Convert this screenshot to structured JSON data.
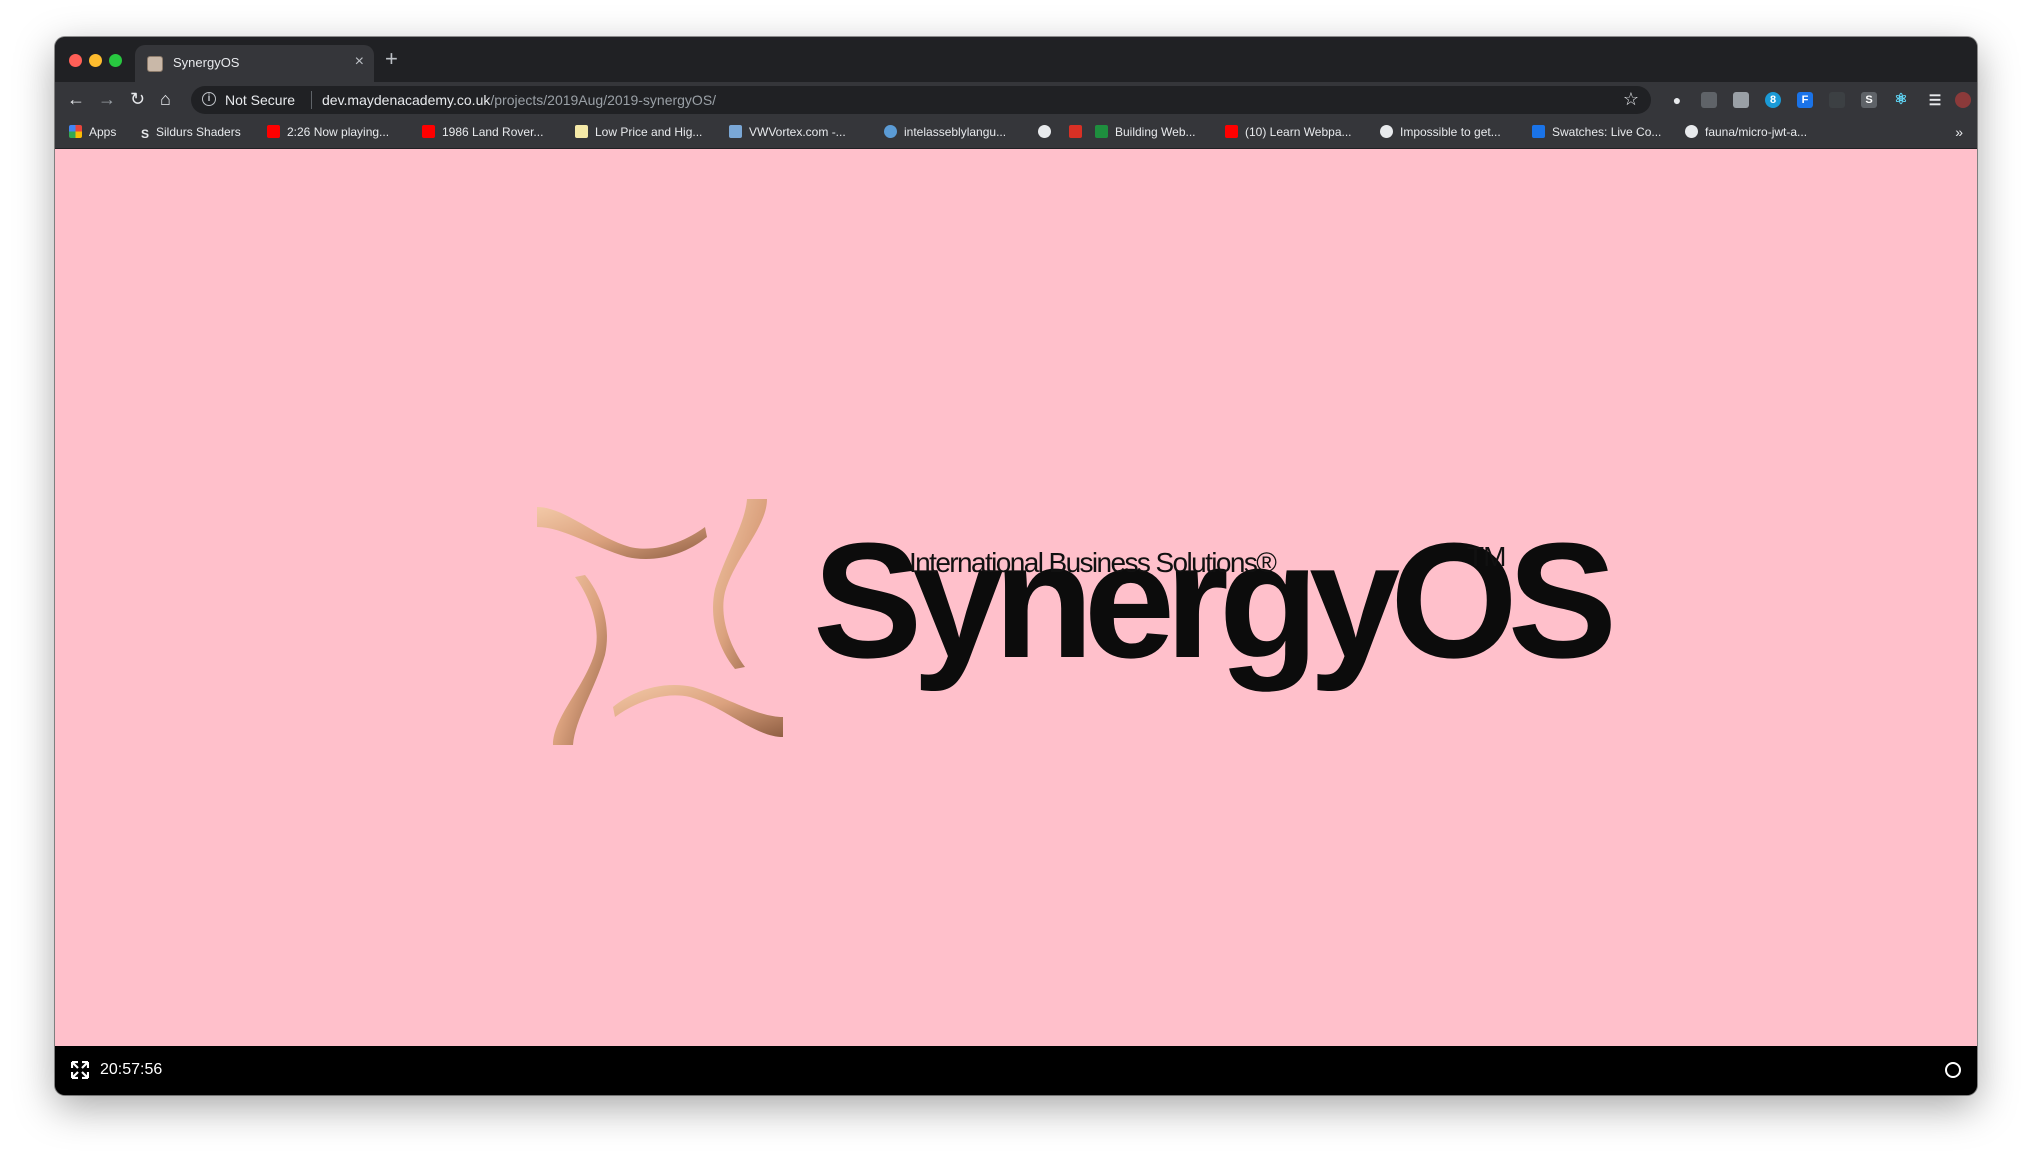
{
  "browser": {
    "tab": {
      "title": "SynergyOS",
      "close_glyph": "×"
    },
    "new_tab_glyph": "+",
    "security_label": "Not Secure",
    "url_host": "dev.maydenacademy.co.uk",
    "url_path": "/projects/2019Aug/2019-synergyOS/",
    "bookmarks": [
      {
        "label": "Apps",
        "icon": "apps-grid-icon",
        "color": "#e8453c"
      },
      {
        "label": "Sildurs Shaders",
        "icon": "letter-s-icon",
        "color": "#35363a"
      },
      {
        "label": "2:26 Now playing...",
        "icon": "youtube-icon",
        "color": "#ff0000"
      },
      {
        "label": "1986 Land Rover...",
        "icon": "youtube-icon",
        "color": "#ff0000"
      },
      {
        "label": "Low Price and Hig...",
        "icon": "note-icon",
        "color": "#f5e9a8"
      },
      {
        "label": "VWVortex.com -...",
        "icon": "vortex-icon",
        "color": "#7aa7d6"
      },
      {
        "label": "intelasseblylangu...",
        "icon": "wordpress-icon",
        "color": "#5b9bd5"
      },
      {
        "label": "",
        "icon": "globe-icon",
        "color": "#e8eaed"
      },
      {
        "label": "",
        "icon": "gmail-icon",
        "color": "#d93025"
      },
      {
        "label": "Building Web...",
        "icon": "folder-green-icon",
        "color": "#1e8e3e"
      },
      {
        "label": "(10) Learn Webpa...",
        "icon": "youtube-icon",
        "color": "#ff0000"
      },
      {
        "label": "Impossible to get...",
        "icon": "globe-icon",
        "color": "#e8eaed"
      },
      {
        "label": "Swatches: Live Co...",
        "icon": "appstore-icon",
        "color": "#1a73e8"
      },
      {
        "label": "fauna/micro-jwt-a...",
        "icon": "github-icon",
        "color": "#e8eaed"
      }
    ],
    "bookmarks_overflow": "»"
  },
  "page": {
    "background": "#ffc0cb",
    "logo": {
      "tagline": "International Business Solutions®",
      "wordmark": "SynergyOS",
      "trademark": "TM"
    }
  },
  "statusbar": {
    "clock": "20:57:56"
  }
}
